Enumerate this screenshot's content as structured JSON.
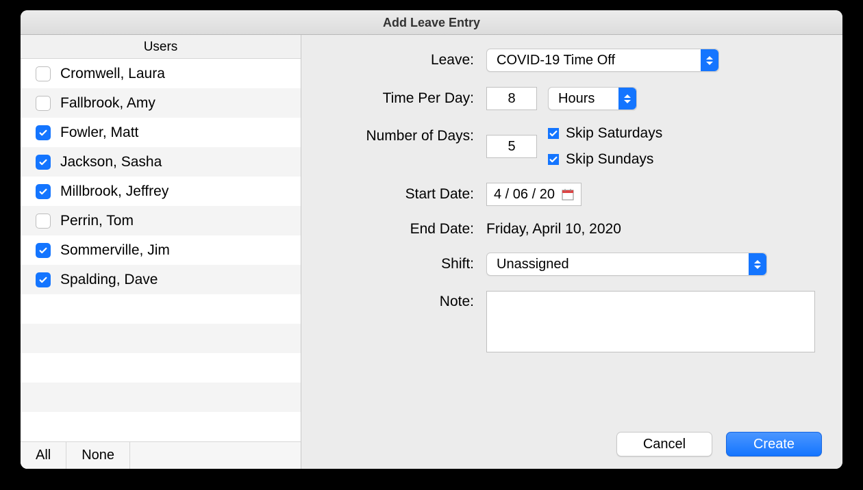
{
  "window": {
    "title": "Add Leave Entry"
  },
  "users": {
    "header": "Users",
    "all_label": "All",
    "none_label": "None",
    "items": [
      {
        "name": "Cromwell, Laura",
        "checked": false
      },
      {
        "name": "Fallbrook, Amy",
        "checked": false
      },
      {
        "name": "Fowler, Matt",
        "checked": true
      },
      {
        "name": "Jackson, Sasha",
        "checked": true
      },
      {
        "name": "Millbrook, Jeffrey",
        "checked": true
      },
      {
        "name": "Perrin, Tom",
        "checked": false
      },
      {
        "name": "Sommerville, Jim",
        "checked": true
      },
      {
        "name": "Spalding, Dave",
        "checked": true
      }
    ]
  },
  "form": {
    "leave_label": "Leave:",
    "leave_value": "COVID-19 Time Off",
    "time_per_day_label": "Time Per Day:",
    "time_per_day_value": "8",
    "time_per_day_units": "Hours",
    "num_days_label": "Number of Days:",
    "num_days_value": "5",
    "skip_sat_label": "Skip Saturdays",
    "skip_sat_checked": true,
    "skip_sun_label": "Skip Sundays",
    "skip_sun_checked": true,
    "start_date_label": "Start Date:",
    "start_date_value": "4 / 06 / 20",
    "end_date_label": "End Date:",
    "end_date_value": "Friday, April 10, 2020",
    "shift_label": "Shift:",
    "shift_value": "Unassigned",
    "note_label": "Note:",
    "note_value": ""
  },
  "buttons": {
    "cancel": "Cancel",
    "create": "Create"
  }
}
